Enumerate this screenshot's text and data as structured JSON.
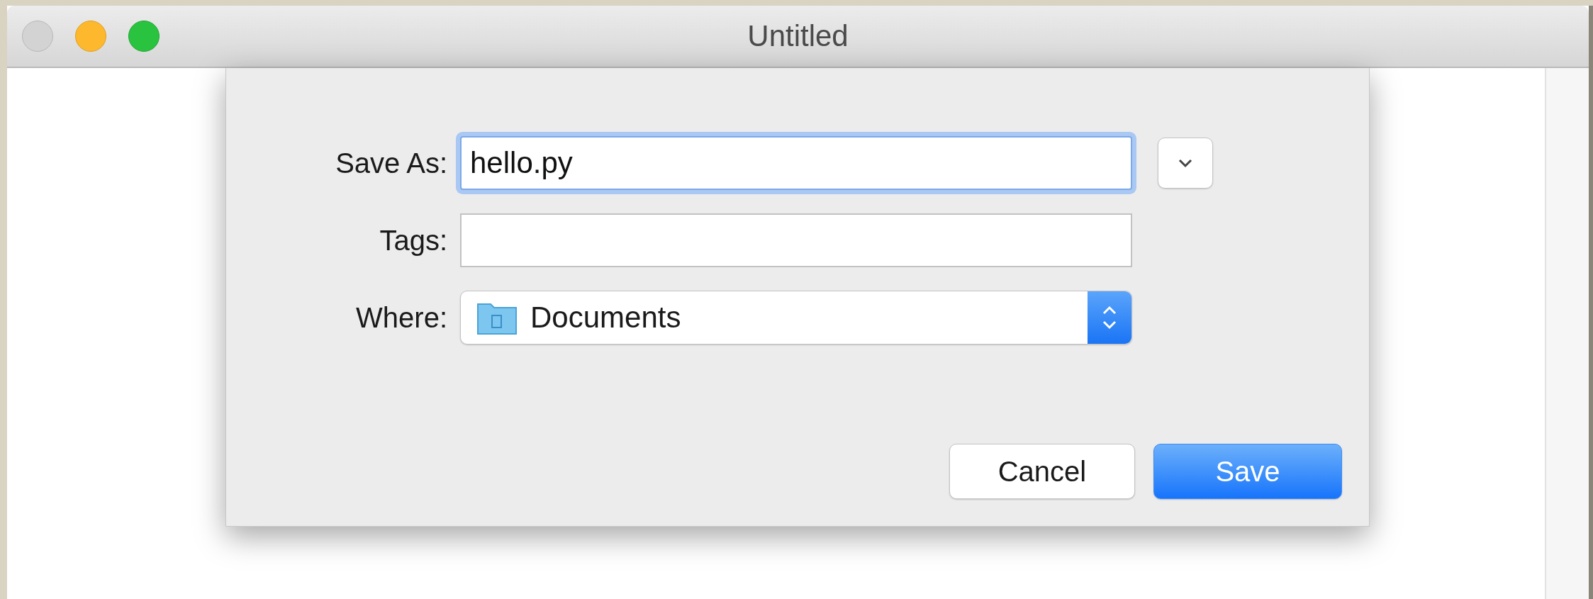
{
  "window": {
    "title": "Untitled"
  },
  "dialog": {
    "fields": [
      {
        "label": "Save As:",
        "kind": "text",
        "value": "hello.py",
        "focused": true,
        "expander": true
      },
      {
        "label": "Tags:",
        "kind": "text",
        "focused": false,
        "expander": false
      },
      {
        "label": "Where:",
        "kind": "popup",
        "value": "Documents"
      }
    ],
    "buttons": [
      {
        "label": "Cancel",
        "default": false
      },
      {
        "label": "Save",
        "default": true
      }
    ]
  }
}
